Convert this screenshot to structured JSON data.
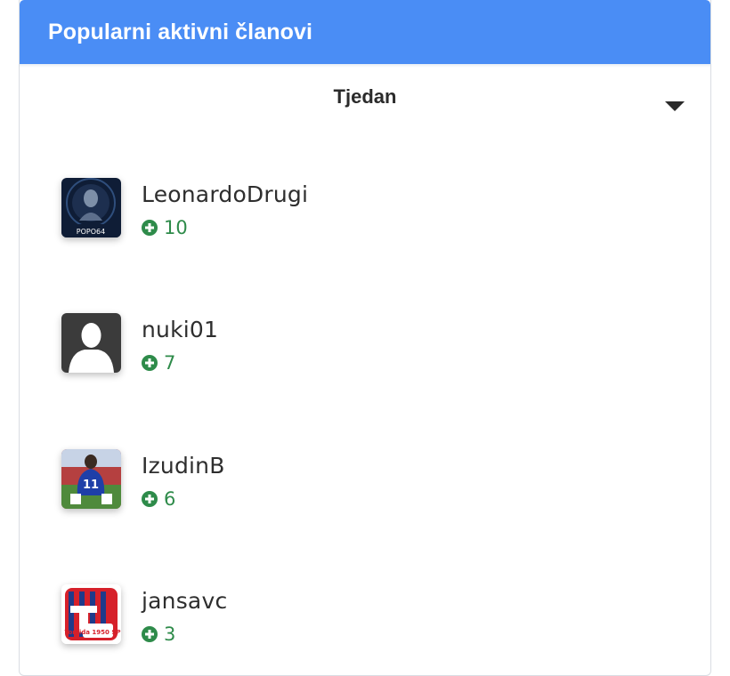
{
  "widget": {
    "title": "Popularni aktivni članovi",
    "filter": {
      "selected": "Tjedan"
    }
  },
  "members": [
    {
      "name": "LeonardoDrugi",
      "reputation": "10",
      "avatar": "portrait-avatar",
      "avatar_text": "POPO64"
    },
    {
      "name": "nuki01",
      "reputation": "7",
      "avatar": "default-user-silhouette"
    },
    {
      "name": "IzudinB",
      "reputation": "6",
      "avatar": "football-player-avatar",
      "avatar_text": "11"
    },
    {
      "name": "jansavc",
      "reputation": "3",
      "avatar": "torcida-logo-avatar",
      "avatar_text": "Torcida 1950 SPLIT"
    }
  ],
  "colors": {
    "header_bg": "#4a8df5",
    "reputation_green": "#2e8b4a"
  }
}
